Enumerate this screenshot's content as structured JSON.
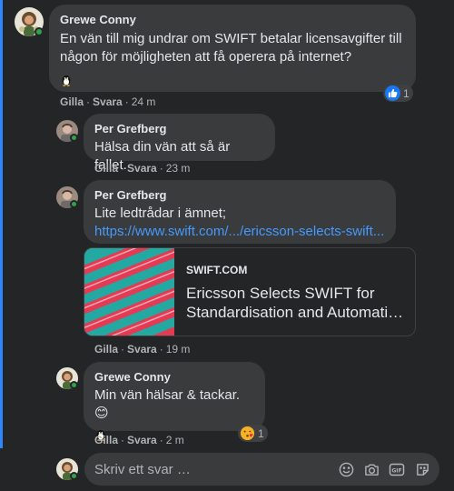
{
  "colors": {
    "background": "#242526",
    "bubble": "#3a3b3c",
    "thread_line": "#2d88ff",
    "link": "#4599ff",
    "meta": "#b0b3b8",
    "online": "#31a24c",
    "like_blue": "#1877f2"
  },
  "actions": {
    "like": "Gilla",
    "reply": "Svara",
    "separator": "·"
  },
  "comments": [
    {
      "author": "Grewe Conny",
      "text": "En vän till mig undrar om SWIFT betalar licensavgifter till någon för möjligheten att få operera på internet?",
      "emoji_icon": "penguin-icon",
      "time": "24 m",
      "reaction_icon": "like-icon",
      "reaction_count": "1"
    },
    {
      "author": "Per Grefberg",
      "text": "Hälsa din vän att så är fallet.",
      "time": "23 m"
    },
    {
      "author": "Per Grefberg",
      "text": "Lite ledtrådar i ämnet;",
      "link": "https://www.swift.com/.../ericsson-selects-swift...",
      "time": "19 m",
      "preview": {
        "domain": "SWIFT.COM",
        "title": "Ericsson Selects SWIFT for Standardisation and Automati…"
      }
    },
    {
      "author": "Grewe Conny",
      "text": "Min vän hälsar & tackar. 😊",
      "emoji_icon": "penguin-icon",
      "time": "2 m",
      "reaction_icon": "kiss-emoji-icon",
      "reaction_count": "1"
    }
  ],
  "reply": {
    "placeholder": "Skriv ett svar …",
    "tools": [
      "smiley-icon",
      "camera-icon",
      "gif-icon",
      "sticker-icon"
    ]
  }
}
